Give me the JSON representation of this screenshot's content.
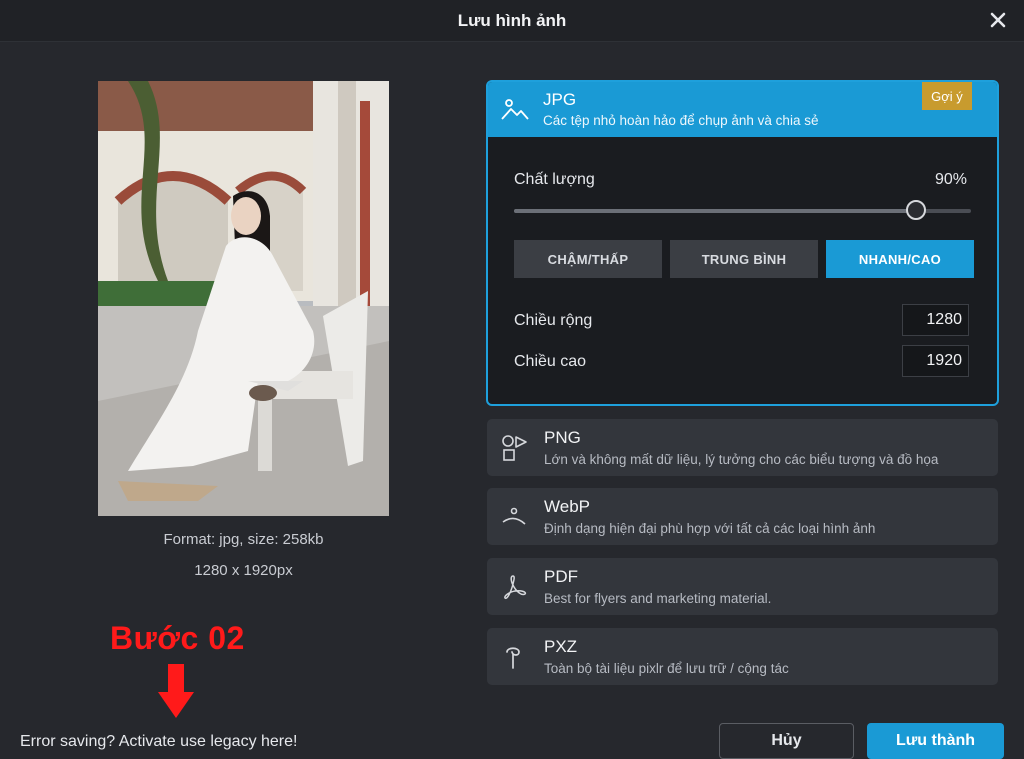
{
  "dialog": {
    "title": "Lưu hình ảnh"
  },
  "preview": {
    "format_line": "Format: jpg, size: 258kb",
    "size_line": "1280 x 1920px"
  },
  "annotation": {
    "step_label": "Bước 02"
  },
  "footer": {
    "legacy_link": "Error saving? Activate use legacy here!",
    "cancel_label": "Hủy",
    "save_label": "Lưu thành"
  },
  "formats": {
    "jpg": {
      "name": "JPG",
      "description": "Các tệp nhỏ hoàn hảo để chụp ảnh và chia sẻ",
      "badge": "Gợi ý",
      "icon": "landscape-icon",
      "quality_label": "Chất lượng",
      "quality_value": "90%",
      "quality_fraction": 0.88,
      "speed_options": [
        "CHẬM/THẤP",
        "TRUNG BÌNH",
        "NHANH/CAO"
      ],
      "speed_selected": "NHANH/CAO",
      "width_label": "Chiều rộng",
      "width_value": "1280",
      "height_label": "Chiều cao",
      "height_value": "1920"
    },
    "png": {
      "name": "PNG",
      "description": "Lớn và không mất dữ liệu, lý tưởng cho các biểu tượng và đồ họa",
      "icon": "shapes-icon"
    },
    "webp": {
      "name": "WebP",
      "description": "Định dạng hiện đại phù hợp với tất cả các loại hình ảnh",
      "icon": "webp-icon"
    },
    "pdf": {
      "name": "PDF",
      "description": "Best for flyers and marketing material.",
      "icon": "pdf-icon"
    },
    "pxz": {
      "name": "PXZ",
      "description": "Toàn bộ tài liệu pixlr để lưu trữ / cộng tác",
      "icon": "pxz-icon"
    }
  },
  "colors": {
    "accent": "#1a9ad5",
    "badge": "#c89b2e",
    "annotation": "#ff1a1a",
    "background": "#26282d"
  }
}
